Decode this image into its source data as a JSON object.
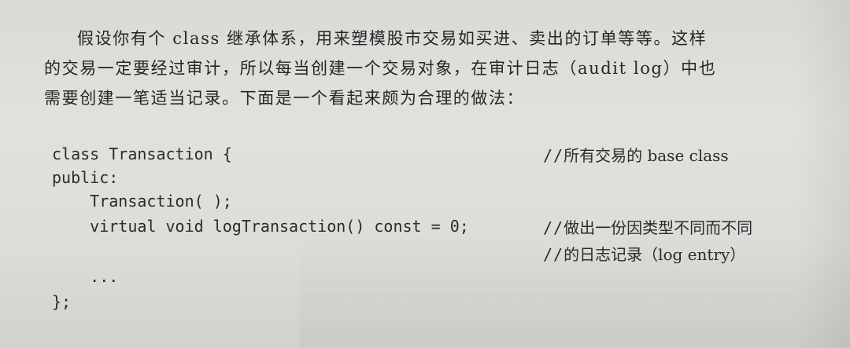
{
  "paragraph": {
    "lines": [
      "假设你有个 class 继承体系，用来塑模股市交易如买进、卖出的订单等等。这样",
      "的交易一定要经过审计，所以每当创建一个交易对象，在审计日志（audit log）中也",
      "需要创建一笔适当记录。下面是一个看起来颇为合理的做法："
    ]
  },
  "code": {
    "lines": [
      "class Transaction {",
      "public:",
      "    Transaction( );",
      "    virtual void logTransaction() const = 0;",
      "",
      "    ...",
      "};"
    ],
    "comments": {
      "c1": "所有交易的 base class",
      "c2": "做出一份因类型不同而不同",
      "c3": "的日志记录（log entry）",
      "slashes": "//"
    }
  }
}
